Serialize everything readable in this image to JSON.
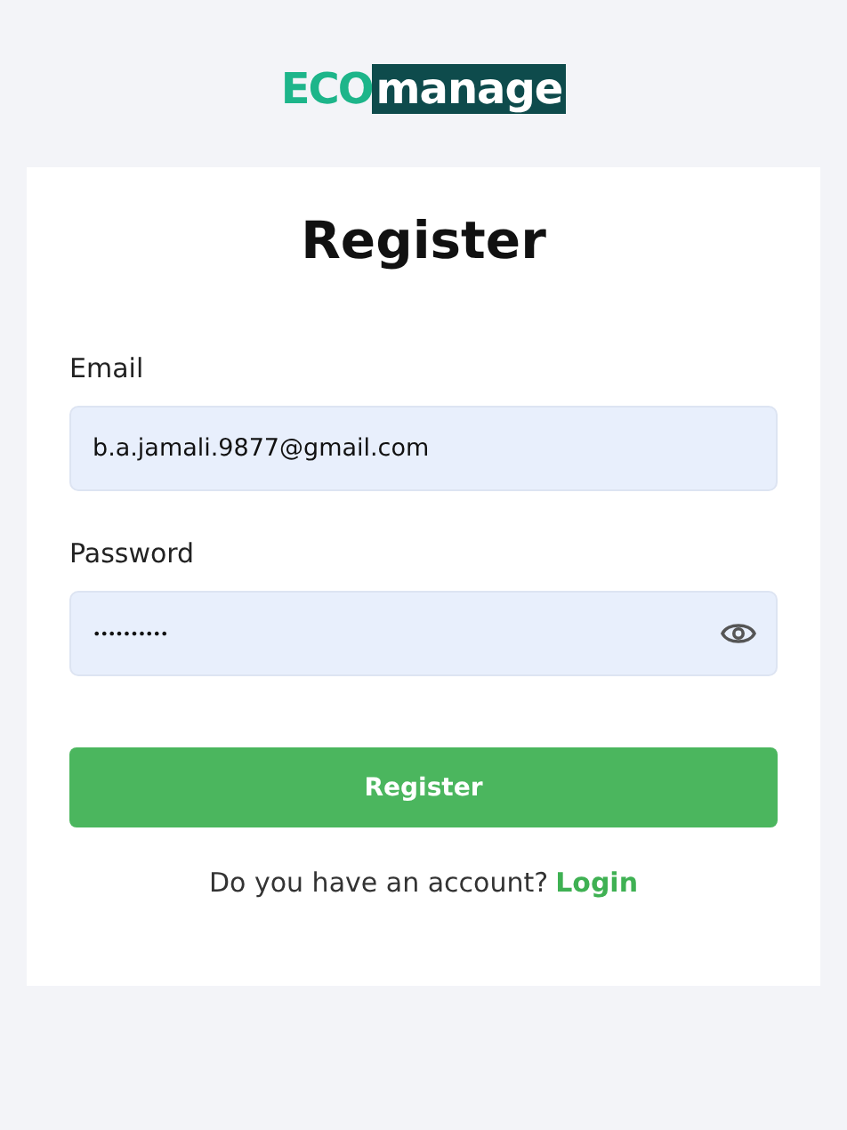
{
  "logo": {
    "accent": "ECO",
    "rest": "manage"
  },
  "form": {
    "title": "Register",
    "fields": [
      {
        "kind": "text",
        "label": "Email",
        "value": "b.a.jamali.9877@gmail.com"
      },
      {
        "kind": "password",
        "label": "Password",
        "value": "••••••••••"
      }
    ],
    "submit": "Register",
    "footer": {
      "text": "Do you have an account?",
      "link": "Login"
    }
  }
}
